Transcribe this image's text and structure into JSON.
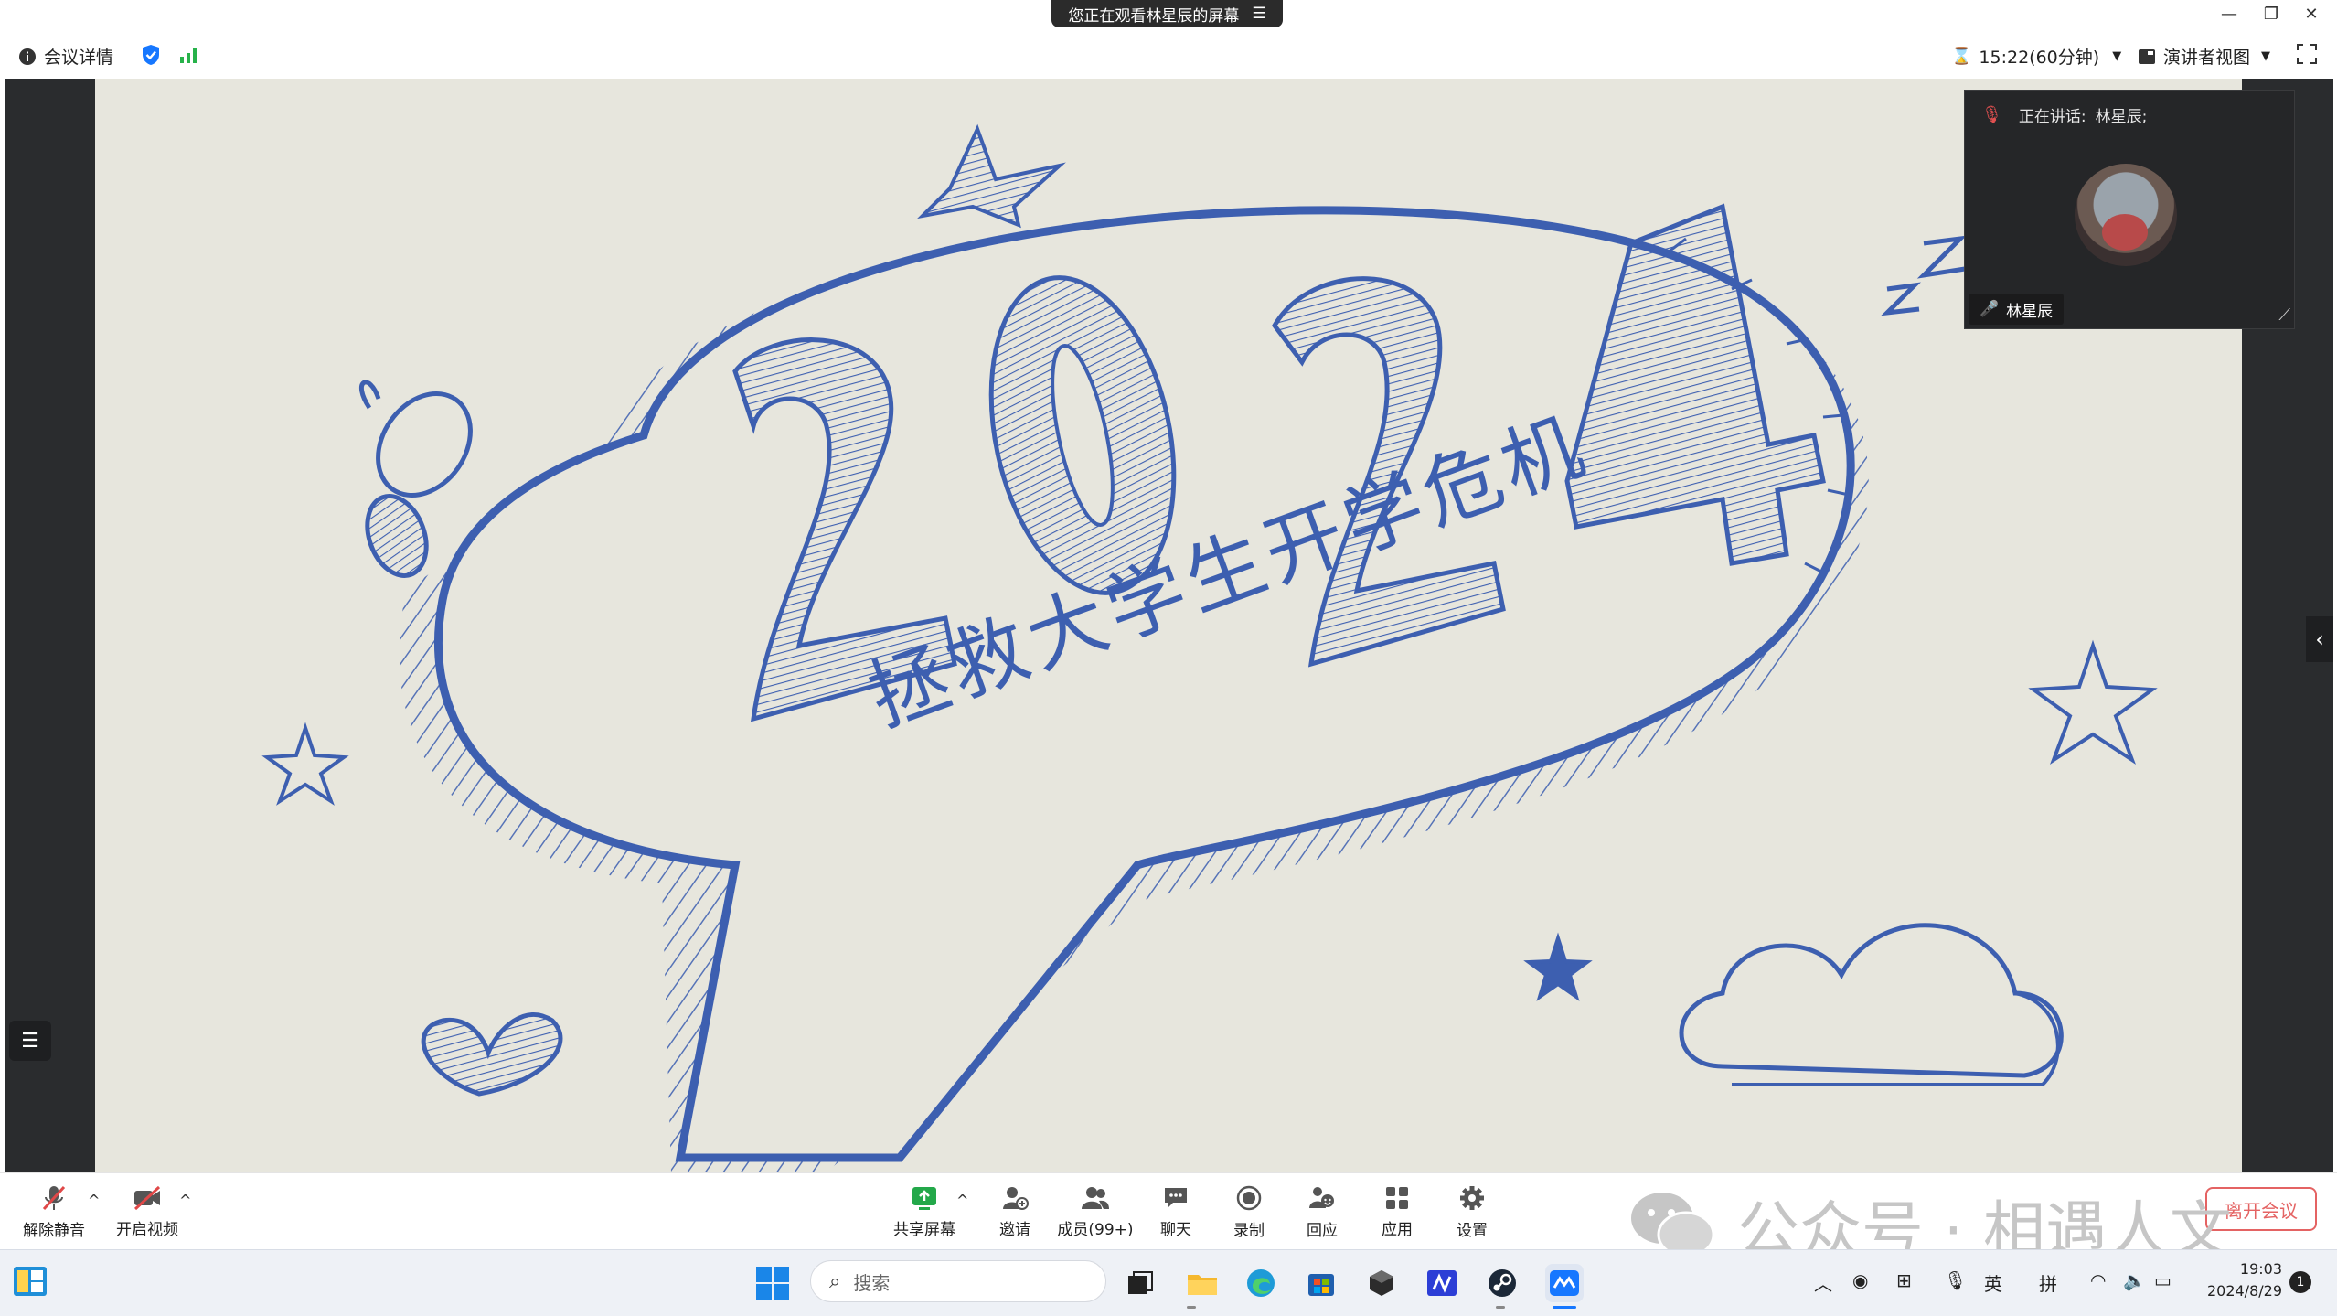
{
  "window": {
    "share_notice": "您正在观看林星辰的屏幕",
    "controls": [
      "minimize",
      "restore",
      "close"
    ]
  },
  "topbar": {
    "meeting_info_label": "会议详情",
    "timer_label": "15:22(60分钟)",
    "view_label": "演讲者视图"
  },
  "slide": {
    "year": "2024",
    "title": "拯救大学生开学危机"
  },
  "speaker": {
    "speaking_prefix": "正在讲话:",
    "speaking_name": "林星辰;",
    "name_tag": "林星辰"
  },
  "toolbar": {
    "left": [
      {
        "label": "解除静音",
        "icon": "muted-mic-icon"
      },
      {
        "label": "开启视频",
        "icon": "video-off-icon"
      }
    ],
    "center": [
      {
        "label": "共享屏幕",
        "icon": "share-screen-icon"
      },
      {
        "label": "邀请",
        "icon": "invite-icon"
      },
      {
        "label": "成员(99+)",
        "icon": "members-icon"
      },
      {
        "label": "聊天",
        "icon": "chat-icon"
      },
      {
        "label": "录制",
        "icon": "record-icon"
      },
      {
        "label": "回应",
        "icon": "reaction-icon"
      },
      {
        "label": "应用",
        "icon": "apps-icon"
      },
      {
        "label": "设置",
        "icon": "settings-icon"
      }
    ],
    "leave_label": "离开会议"
  },
  "watermark": "公众号 · 相遇人文",
  "taskbar": {
    "search_placeholder": "搜索",
    "tray": {
      "ime_lang": "英",
      "ime_mode": "拼",
      "time": "19:03",
      "date": "2024/8/29",
      "notification_count": "1"
    }
  },
  "colors": {
    "accent_blue": "#1677ff",
    "sketch_blue": "#3d5fb0",
    "signal_green": "#27b24a",
    "leave_red": "#e04848",
    "stage_dark": "#2a2c2e"
  }
}
